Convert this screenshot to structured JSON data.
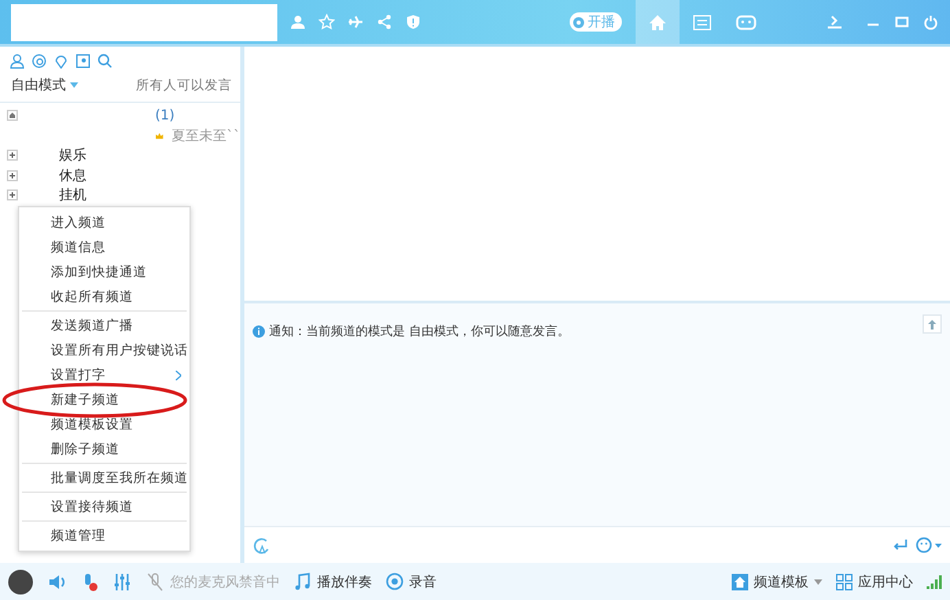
{
  "top_bar": {
    "live_toggle": {
      "label": "开播",
      "on": false
    },
    "tabs": [
      {
        "kind": "home",
        "selected": true
      },
      {
        "kind": "list",
        "selected": false
      },
      {
        "kind": "game",
        "selected": false
      }
    ]
  },
  "sidebar": {
    "mode": "自由模式",
    "permission": "所有人可以发言",
    "tree": [
      {
        "kind": "root",
        "label": "(1)"
      },
      {
        "kind": "user",
        "label": "夏至未至``"
      },
      {
        "kind": "channel",
        "label": "娱乐",
        "expanded": false
      },
      {
        "kind": "channel",
        "label": "休息",
        "expanded": false
      },
      {
        "kind": "channel",
        "label": "挂机",
        "expanded": false
      }
    ]
  },
  "context_menu": [
    {
      "kind": "item",
      "label": "进入频道",
      "circled": false
    },
    {
      "kind": "item",
      "label": "频道信息",
      "circled": false
    },
    {
      "kind": "item",
      "label": "添加到快捷通道",
      "circled": false
    },
    {
      "kind": "item",
      "label": "收起所有频道",
      "circled": false
    },
    {
      "kind": "separator"
    },
    {
      "kind": "item",
      "label": "发送频道广播",
      "circled": false
    },
    {
      "kind": "item",
      "label": "设置所有用户按键说话",
      "circled": false
    },
    {
      "kind": "submenu",
      "label": "设置打字",
      "circled": false
    },
    {
      "kind": "item",
      "label": "新建子频道",
      "circled": true
    },
    {
      "kind": "item",
      "label": "频道模板设置",
      "circled": false
    },
    {
      "kind": "item",
      "label": "删除子频道",
      "circled": false
    },
    {
      "kind": "separator"
    },
    {
      "kind": "item",
      "label": "批量调度至我所在频道",
      "circled": false
    },
    {
      "kind": "separator"
    },
    {
      "kind": "item",
      "label": "设置接待频道",
      "circled": false
    },
    {
      "kind": "separator"
    },
    {
      "kind": "item",
      "label": "频道管理",
      "circled": false
    }
  ],
  "notice": "通知：当前频道的模式是 自由模式，你可以随意发言。",
  "bottom_bar": {
    "mic_status": "您的麦克风禁音中",
    "accompaniment": "播放伴奏",
    "record": "录音",
    "template": "频道模板",
    "app_center": "应用中心"
  }
}
